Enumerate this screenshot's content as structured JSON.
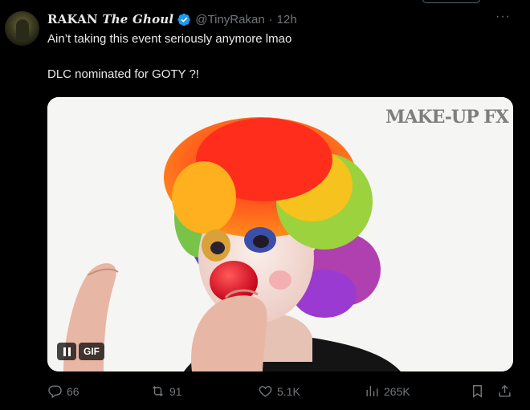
{
  "tweet": {
    "display_name_part1": "RAKAN",
    "display_name_part2": "The Ghoul",
    "handle": "@TinyRakan",
    "separator": "·",
    "time": "12h",
    "more_label": "···",
    "text_line1": "Ain’t taking this event seriously anymore lmao",
    "text_line2": "DLC nominated for GOTY ?!"
  },
  "media": {
    "watermark": "MAKE-UP FX",
    "gif_badge": "GIF"
  },
  "actions": {
    "replies": "66",
    "reposts": "91",
    "likes": "5.1K",
    "views": "265K"
  },
  "colors": {
    "background": "#000000",
    "text_primary": "#e7e9ea",
    "text_secondary": "#71767b",
    "verified_blue": "#1d9bf0"
  },
  "icons": [
    "verified-badge-icon",
    "more-icon",
    "reply-icon",
    "repost-icon",
    "like-icon",
    "views-icon",
    "bookmark-icon",
    "share-icon",
    "pause-icon"
  ]
}
